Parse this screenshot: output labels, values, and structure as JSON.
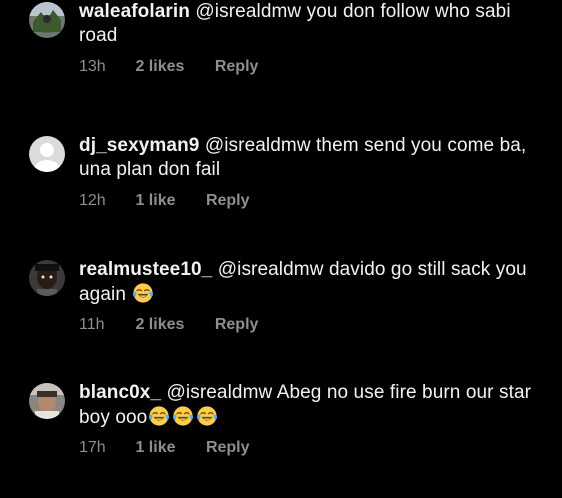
{
  "comments": [
    {
      "username": "waleafolarin",
      "mention": "@isrealdmw",
      "text": "you don follow who sabi road",
      "time": "13h",
      "likes": "2 likes",
      "reply": "Reply",
      "emoji_count": 0
    },
    {
      "username": "dj_sexyman9",
      "mention": "@isrealdmw",
      "text": "them send you come ba, una plan don fail",
      "time": "12h",
      "likes": "1 like",
      "reply": "Reply",
      "emoji_count": 0
    },
    {
      "username": "realmustee10_",
      "mention": "@isrealdmw",
      "text": "davido go still sack you again",
      "time": "11h",
      "likes": "2 likes",
      "reply": "Reply",
      "emoji_count": 1
    },
    {
      "username": "blanc0x_",
      "mention": "@isrealdmw",
      "text": "Abeg no use fire burn our star boy ooo",
      "time": "17h",
      "likes": "1 like",
      "reply": "Reply",
      "emoji_count": 3
    }
  ],
  "emoji_name": "face-with-tears-of-joy-icon",
  "colors": {
    "background": "#000000",
    "text": "#f2f2f2",
    "meta": "#8e8e8e"
  }
}
